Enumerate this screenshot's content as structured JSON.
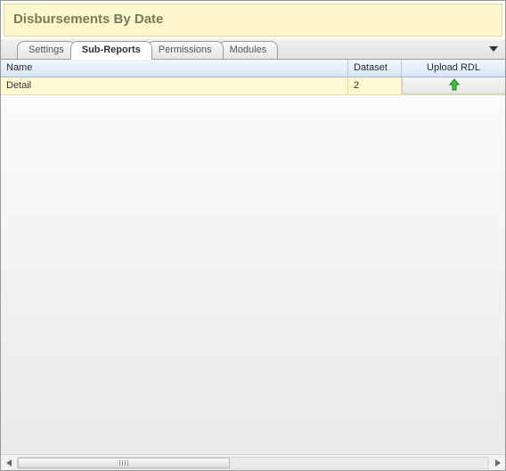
{
  "title": "Disbursements By Date",
  "tabs": [
    {
      "label": "Settings"
    },
    {
      "label": "Sub-Reports"
    },
    {
      "label": "Permissions"
    },
    {
      "label": "Modules"
    }
  ],
  "active_tab": "Sub-Reports",
  "columns": {
    "name": "Name",
    "dataset": "Dataset",
    "upload": "Upload RDL"
  },
  "rows": [
    {
      "name": "Detail",
      "dataset": "2"
    }
  ]
}
